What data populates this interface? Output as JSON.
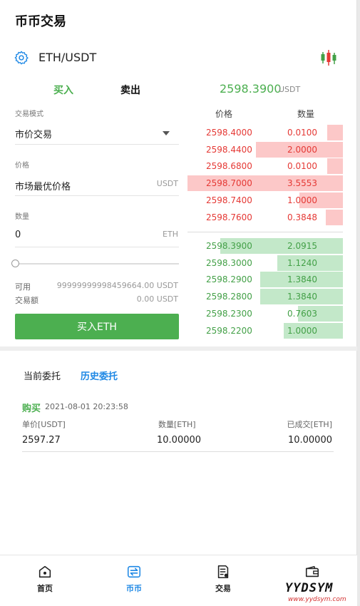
{
  "header": {
    "title": "币币交易"
  },
  "pair": {
    "name": "ETH/USDT"
  },
  "trade_tabs": {
    "buy": "买入",
    "sell": "卖出"
  },
  "ticker": {
    "last_price": "2598.3900",
    "unit": "USDT"
  },
  "form": {
    "mode_label": "交易模式",
    "mode_value": "市价交易",
    "price_label": "价格",
    "price_value": "市场最优价格",
    "price_unit": "USDT",
    "qty_label": "数量",
    "qty_value": "0",
    "qty_unit": "ETH",
    "slider_percent": 0,
    "available_label": "可用",
    "available_value": "99999999998459664.00 USDT",
    "amount_label": "交易额",
    "amount_value": "0.00 USDT",
    "submit_label": "买入ETH"
  },
  "orderbook": {
    "price_header": "价格",
    "qty_header": "数量",
    "asks": [
      {
        "price": "2598.4000",
        "qty": "0.0100",
        "depth": 0.1
      },
      {
        "price": "2598.4400",
        "qty": "2.0000",
        "depth": 0.56
      },
      {
        "price": "2598.6800",
        "qty": "0.0100",
        "depth": 0.1
      },
      {
        "price": "2598.7000",
        "qty": "3.5553",
        "depth": 1.0
      },
      {
        "price": "2598.7400",
        "qty": "1.0000",
        "depth": 0.28
      },
      {
        "price": "2598.7600",
        "qty": "0.3848",
        "depth": 0.11
      }
    ],
    "bids": [
      {
        "price": "2598.3900",
        "qty": "2.0915",
        "depth": 0.79
      },
      {
        "price": "2598.3000",
        "qty": "1.1240",
        "depth": 0.42
      },
      {
        "price": "2598.2900",
        "qty": "1.3840",
        "depth": 0.53
      },
      {
        "price": "2598.2800",
        "qty": "1.3840",
        "depth": 0.53
      },
      {
        "price": "2598.2300",
        "qty": "0.7603",
        "depth": 0.29
      },
      {
        "price": "2598.2200",
        "qty": "1.0000",
        "depth": 0.38
      }
    ]
  },
  "orders": {
    "tab_current": "当前委托",
    "tab_history": "历史委托",
    "item": {
      "side": "购买",
      "time": "2021-08-01 20:23:58",
      "col_price": "单价[USDT]",
      "col_qty": "数量[ETH]",
      "col_filled": "已成交[ETH]",
      "price": "2597.27",
      "qty": "10.00000",
      "filled": "10.00000"
    }
  },
  "nav": [
    {
      "label": "首页",
      "icon": "home-icon"
    },
    {
      "label": "币币",
      "icon": "exchange-icon"
    },
    {
      "label": "交易",
      "icon": "document-icon"
    },
    {
      "label": "",
      "icon": "wallet-icon"
    }
  ],
  "watermark": {
    "main": "YYDSYM",
    "sub": "www.yydsym.com"
  },
  "colors": {
    "green": "#4caf50",
    "red": "#e53935",
    "blue": "#1e88e5"
  }
}
